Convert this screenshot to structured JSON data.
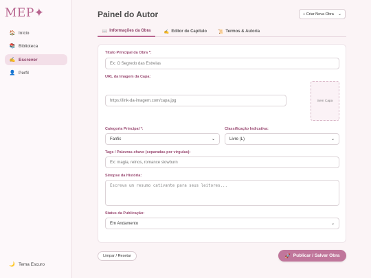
{
  "sidebar": {
    "logo": "MEP✦",
    "items": [
      {
        "icon": "🏠",
        "icon_name": "home-icon",
        "label": "Início"
      },
      {
        "icon": "📚",
        "icon_name": "books-icon",
        "label": "Biblioteca"
      },
      {
        "icon": "✍️",
        "icon_name": "writing-hand-icon",
        "label": "Escrever"
      },
      {
        "icon": "👤",
        "icon_name": "user-icon",
        "label": "Perfil"
      }
    ],
    "active_index": 2,
    "theme_toggle": {
      "icon": "🌙",
      "icon_name": "moon-icon",
      "label": "Tema Escuro"
    }
  },
  "header": {
    "title": "Painel do Autor",
    "create_select": "+ Criar Nova Obra"
  },
  "tabs": [
    {
      "icon": "📖",
      "icon_name": "book-icon",
      "label": "Informações da Obra"
    },
    {
      "icon": "✍️",
      "icon_name": "writing-hand-icon",
      "label": "Editor de Capítulo"
    },
    {
      "icon": "📜",
      "icon_name": "scroll-icon",
      "label": "Termos & Autoria"
    }
  ],
  "form": {
    "title_label": "Título Principal da Obra *:",
    "title_placeholder": "Ex: O Segredo das Estrelas",
    "cover_label": "URL da Imagem da Capa:",
    "cover_placeholder": "https://link-da-imagem.com/capa.jpg",
    "cover_preview": "Sem Capa",
    "category_label": "Categoria Principal *:",
    "category_value": "Fanfic",
    "rating_label": "Classificação Indicativa:",
    "rating_value": "Livre (L)",
    "tags_label": "Tags / Palavras-chave (separadas por vírgulas):",
    "tags_placeholder": "Ex: magia, reinos, romance slowburn",
    "synopsis_label": "Sinopse da História:",
    "synopsis_placeholder": "Escreva um resumo cativante para seus leitores...",
    "status_label": "Status da Publicação:",
    "status_value": "Em Andamento"
  },
  "actions": {
    "reset_label": "Limpar / Resetar",
    "publish_icon": "🚀",
    "publish_label": "Publicar / Salvar Obra"
  },
  "colors": {
    "accent": "#b8658f",
    "publish_button": "#c0769b",
    "background": "#fbf4f6"
  }
}
